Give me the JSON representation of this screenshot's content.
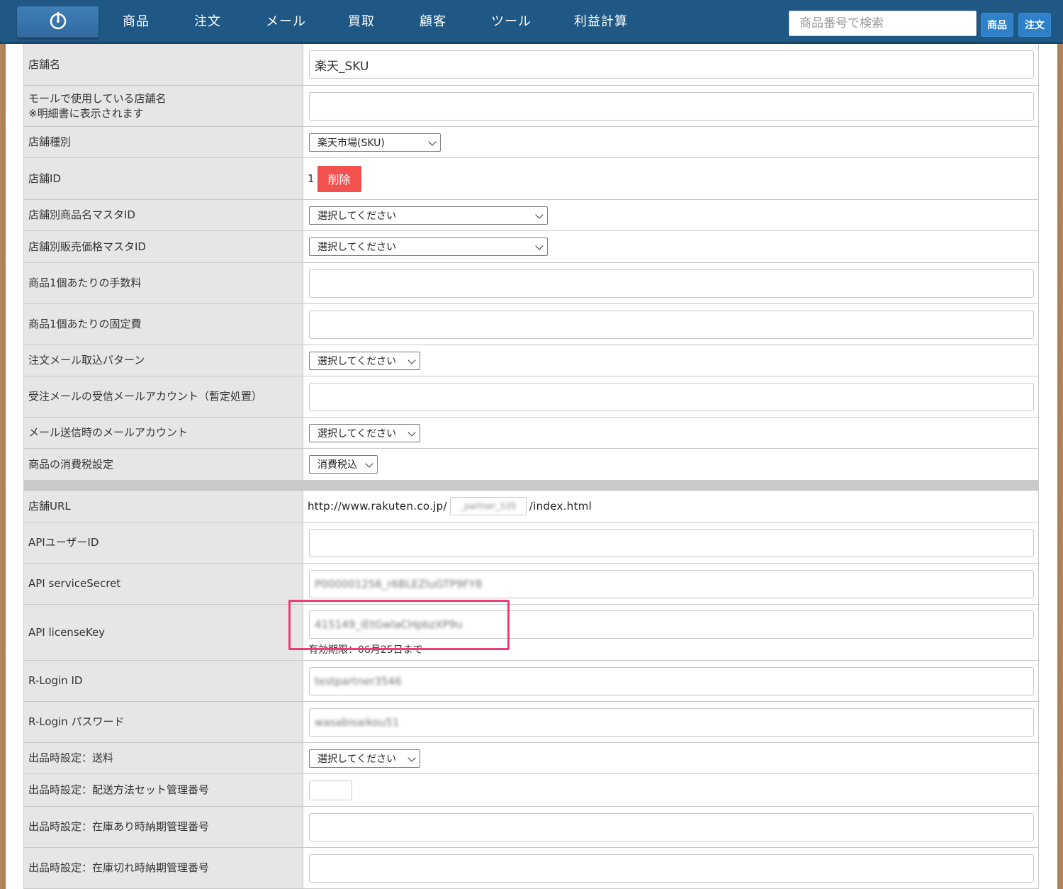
{
  "nav": {
    "items": [
      "商品",
      "注文",
      "メール",
      "買取",
      "顧客",
      "ツール",
      "利益計算"
    ],
    "search_placeholder": "商品番号で検索",
    "search_product_btn": "商品",
    "search_order_btn": "注文"
  },
  "form": {
    "shop_name": {
      "label": "店舗名",
      "value": "楽天_SKU"
    },
    "mall_shop_name": {
      "label_line1": "モールで使用している店舗名",
      "label_line2": "※明細書に表示されます",
      "value": ""
    },
    "shop_type": {
      "label": "店舗種別",
      "value": "楽天市場(SKU)"
    },
    "shop_id": {
      "label": "店舗ID",
      "value": "1",
      "delete_label": "削除"
    },
    "name_master": {
      "label": "店舗別商品名マスタID",
      "value": "選択してください"
    },
    "price_master": {
      "label": "店舗別販売価格マスタID",
      "value": "選択してください"
    },
    "fee_per_item": {
      "label": "商品1個あたりの手数料",
      "value": ""
    },
    "fixed_cost": {
      "label": "商品1個あたりの固定費",
      "value": ""
    },
    "mail_pattern": {
      "label": "注文メール取込パターン",
      "value": "選択してください"
    },
    "recv_mail_account": {
      "label": "受注メールの受信メールアカウント（暫定処置）",
      "value": ""
    },
    "send_mail_account": {
      "label": "メール送信時のメールアカウント",
      "value": "選択してください"
    },
    "tax_setting": {
      "label": "商品の消費税設定",
      "value": "消費税込"
    },
    "shop_url": {
      "label": "店舗URL",
      "prefix": "http://www.rakuten.co.jp/",
      "slug": "_partner_535",
      "suffix": "/index.html"
    },
    "api_user_id": {
      "label": "APIユーザーID",
      "value": ""
    },
    "api_service_secret": {
      "label": "API serviceSecret",
      "value": "P000001256_r6BLEZluGTP9FY8"
    },
    "api_license_key": {
      "label": "API licenseKey",
      "value": "415149_iEtGwlaCHpbzXP9u",
      "expiry": "有効期限：06月25日まで"
    },
    "rlogin_id": {
      "label": "R-Login ID",
      "value": "testpartner3546"
    },
    "rlogin_password": {
      "label": "R-Login パスワード",
      "value": "wasabisaikou51"
    },
    "listing_shipping": {
      "label": "出品時設定：送料",
      "value": "選択してください"
    },
    "listing_delivery_set": {
      "label": "出品時設定：配送方法セット管理番号",
      "value": ""
    },
    "listing_instock_period": {
      "label": "出品時設定：在庫あり時納期管理番号",
      "value": ""
    },
    "listing_outstock_period": {
      "label": "出品時設定：在庫切れ時納期管理番号",
      "value": ""
    }
  },
  "colors": {
    "nav_bg": "#1f5785",
    "delete_btn": "#f1524f",
    "highlight": "#ee3b7a"
  }
}
